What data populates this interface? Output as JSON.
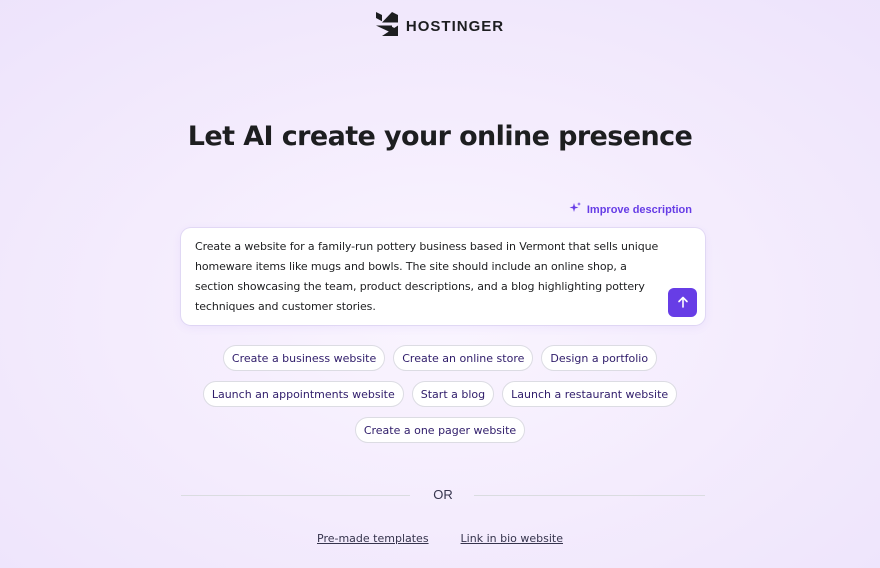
{
  "brand": {
    "name": "HOSTINGER",
    "logo_icon": "hostinger-logo-icon"
  },
  "headline": "Let AI create your online presence",
  "improve": {
    "label": "Improve description",
    "icon": "sparkle-icon"
  },
  "prompt": {
    "value": "Create a website for a family-run pottery business based in Vermont that sells unique homeware items like mugs and bowls. The site should include an online shop, a section showcasing the team, product descriptions, and a blog highlighting pottery techniques and customer stories.",
    "submit_icon": "arrow-up-icon"
  },
  "suggestions": [
    [
      "Create a business website",
      "Create an online store",
      "Design a portfolio"
    ],
    [
      "Launch an appointments website",
      "Start a blog",
      "Launch a restaurant website"
    ],
    [
      "Create a one pager website"
    ]
  ],
  "divider": {
    "label": "OR"
  },
  "links": [
    "Pre-made templates",
    "Link in bio website"
  ],
  "colors": {
    "accent": "#673de6",
    "text": "#1d1e20",
    "chip_border": "#dcdce3"
  }
}
